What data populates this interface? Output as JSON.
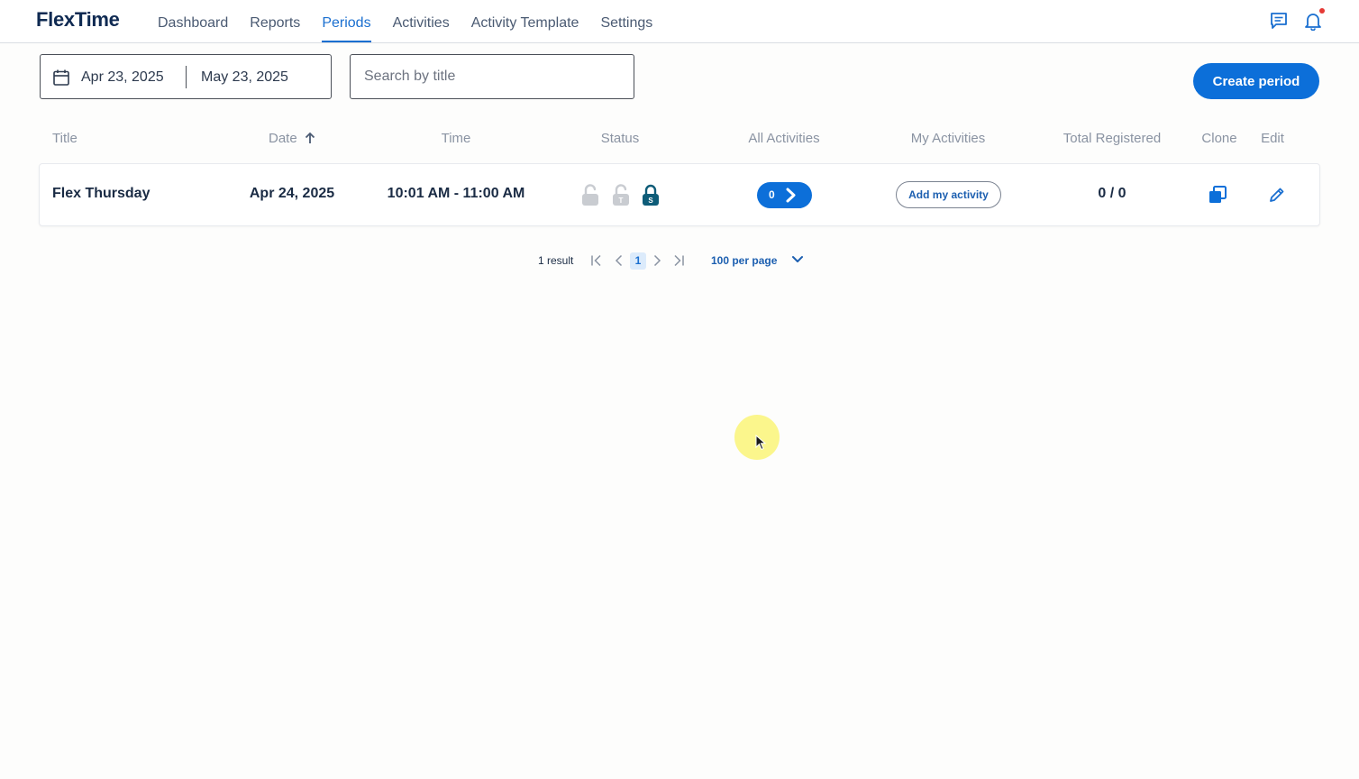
{
  "app": {
    "logo": "FlexTime"
  },
  "nav": {
    "items": [
      {
        "label": "Dashboard",
        "active": false
      },
      {
        "label": "Reports",
        "active": false
      },
      {
        "label": "Periods",
        "active": true
      },
      {
        "label": "Activities",
        "active": false
      },
      {
        "label": "Activity Template",
        "active": false
      },
      {
        "label": "Settings",
        "active": false
      }
    ],
    "icons": [
      "chat-icon",
      "bell-icon"
    ],
    "has_notification": true
  },
  "filters": {
    "date_start": "Apr 23, 2025",
    "date_end": "May 23, 2025",
    "search_placeholder": "Search by title",
    "search_value": ""
  },
  "create_button": "Create period",
  "table": {
    "columns": [
      "Title",
      "Date",
      "Time",
      "Status",
      "All Activities",
      "My Activities",
      "Total Registered",
      "Clone",
      "Edit"
    ],
    "sort": {
      "column": "Date",
      "direction": "ascending"
    },
    "rows": [
      {
        "title": "Flex Thursday",
        "date": "Apr 24, 2025",
        "time": "10:01 AM - 11:00 AM",
        "status_locks": [
          {
            "label": "",
            "locked": false,
            "active": false
          },
          {
            "label": "T",
            "locked": false,
            "active": false
          },
          {
            "label": "S",
            "locked": true,
            "active": true
          }
        ],
        "all_activities_count": "0",
        "my_activities_button": "Add my activity",
        "total_registered": "0 / 0"
      }
    ]
  },
  "pagination": {
    "result_text": "1 result",
    "current_page": "1",
    "per_page": "100 per page"
  },
  "colors": {
    "primary": "#0c6fd9",
    "nav_active": "#1a6fd0",
    "text_dark": "#1a2b44",
    "header_text": "#8a93a2",
    "lock_active": "#0e5c78",
    "lock_inactive": "#c9ccd1",
    "notification": "#e53935"
  }
}
